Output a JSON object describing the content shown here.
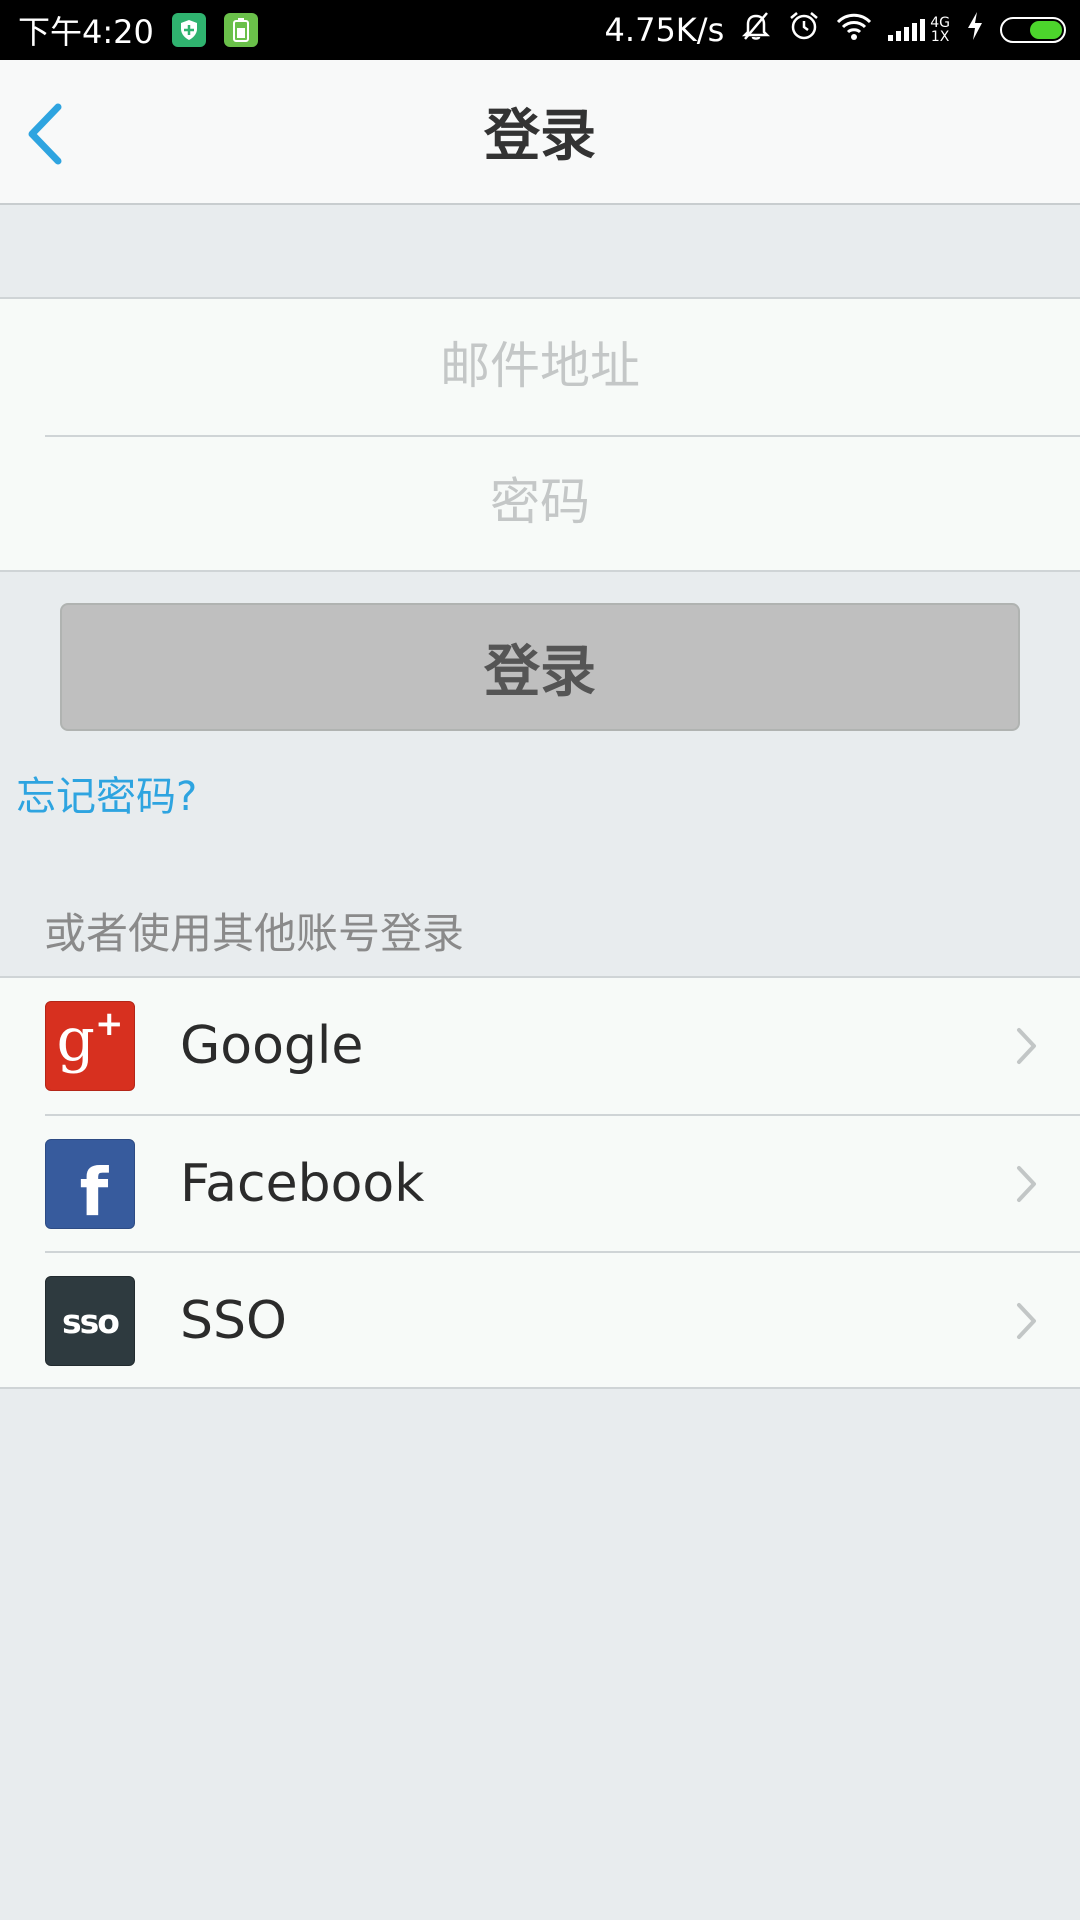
{
  "status_bar": {
    "time": "下午4:20",
    "net_speed": "4.75K/s",
    "network_type_top": "4G",
    "network_type_bottom": "1X",
    "icons": [
      "shield-icon",
      "battery-saver-icon",
      "mute-bell-icon",
      "alarm-icon",
      "wifi-icon",
      "signal-icon",
      "charging-icon",
      "battery-icon"
    ]
  },
  "header": {
    "title": "登录",
    "back_icon": "chevron-left-icon"
  },
  "form": {
    "email_placeholder": "邮件地址",
    "email_value": "",
    "password_placeholder": "密码",
    "password_value": ""
  },
  "login_button": {
    "label": "登录"
  },
  "forgot_password": "忘记密码?",
  "alt_login": {
    "title": "或者使用其他账号登录",
    "providers": [
      {
        "label": "Google",
        "icon": "google-plus-icon"
      },
      {
        "label": "Facebook",
        "icon": "facebook-icon"
      },
      {
        "label": "SSO",
        "icon": "sso-icon"
      }
    ]
  },
  "colors": {
    "accent": "#2ea4e0",
    "page_bg": "#e8ecee",
    "button_bg": "#bfbfbf",
    "google": "#d7301f",
    "facebook": "#375b9d",
    "sso": "#2e3a3f"
  }
}
